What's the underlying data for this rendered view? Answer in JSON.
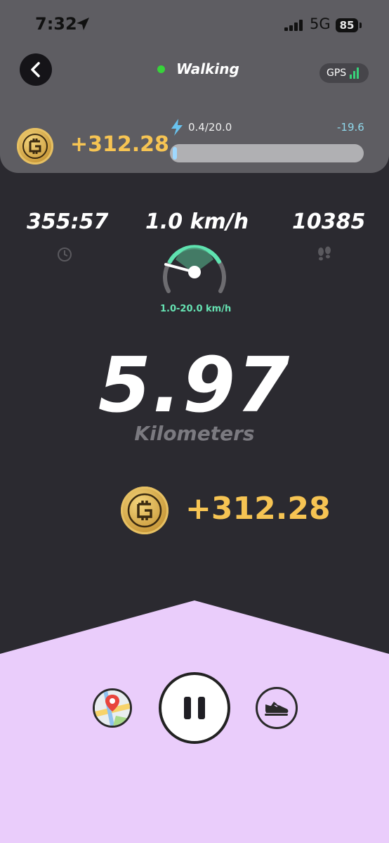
{
  "status_bar": {
    "time": "7:32",
    "network": "5G",
    "battery": "85"
  },
  "header": {
    "mode": "Walking",
    "gps_label": "GPS",
    "earned": "+312.28",
    "energy": {
      "text": "0.4/20.0",
      "delta": "-19.6",
      "level_fraction": 0.02
    }
  },
  "stats": {
    "duration": "355:57",
    "speed": "1.0 km/h",
    "steps": "10385",
    "speed_range": "1.0-20.0 km/h"
  },
  "distance": {
    "value": "5.97",
    "unit": "Kilometers"
  },
  "earnings": {
    "value": "+312.28"
  },
  "colors": {
    "accent_gold": "#f6c453",
    "active_green": "#37d33a",
    "gauge_green": "#5fe3b0",
    "bottom_panel": "#eacdfb"
  },
  "icons": {
    "back": "chevron-left-icon",
    "location": "location-arrow-icon",
    "energy": "lightning-icon",
    "clock": "clock-icon",
    "steps": "footprints-icon",
    "map": "map-pin-icon",
    "pause": "pause-icon",
    "shoe": "sneaker-icon"
  }
}
